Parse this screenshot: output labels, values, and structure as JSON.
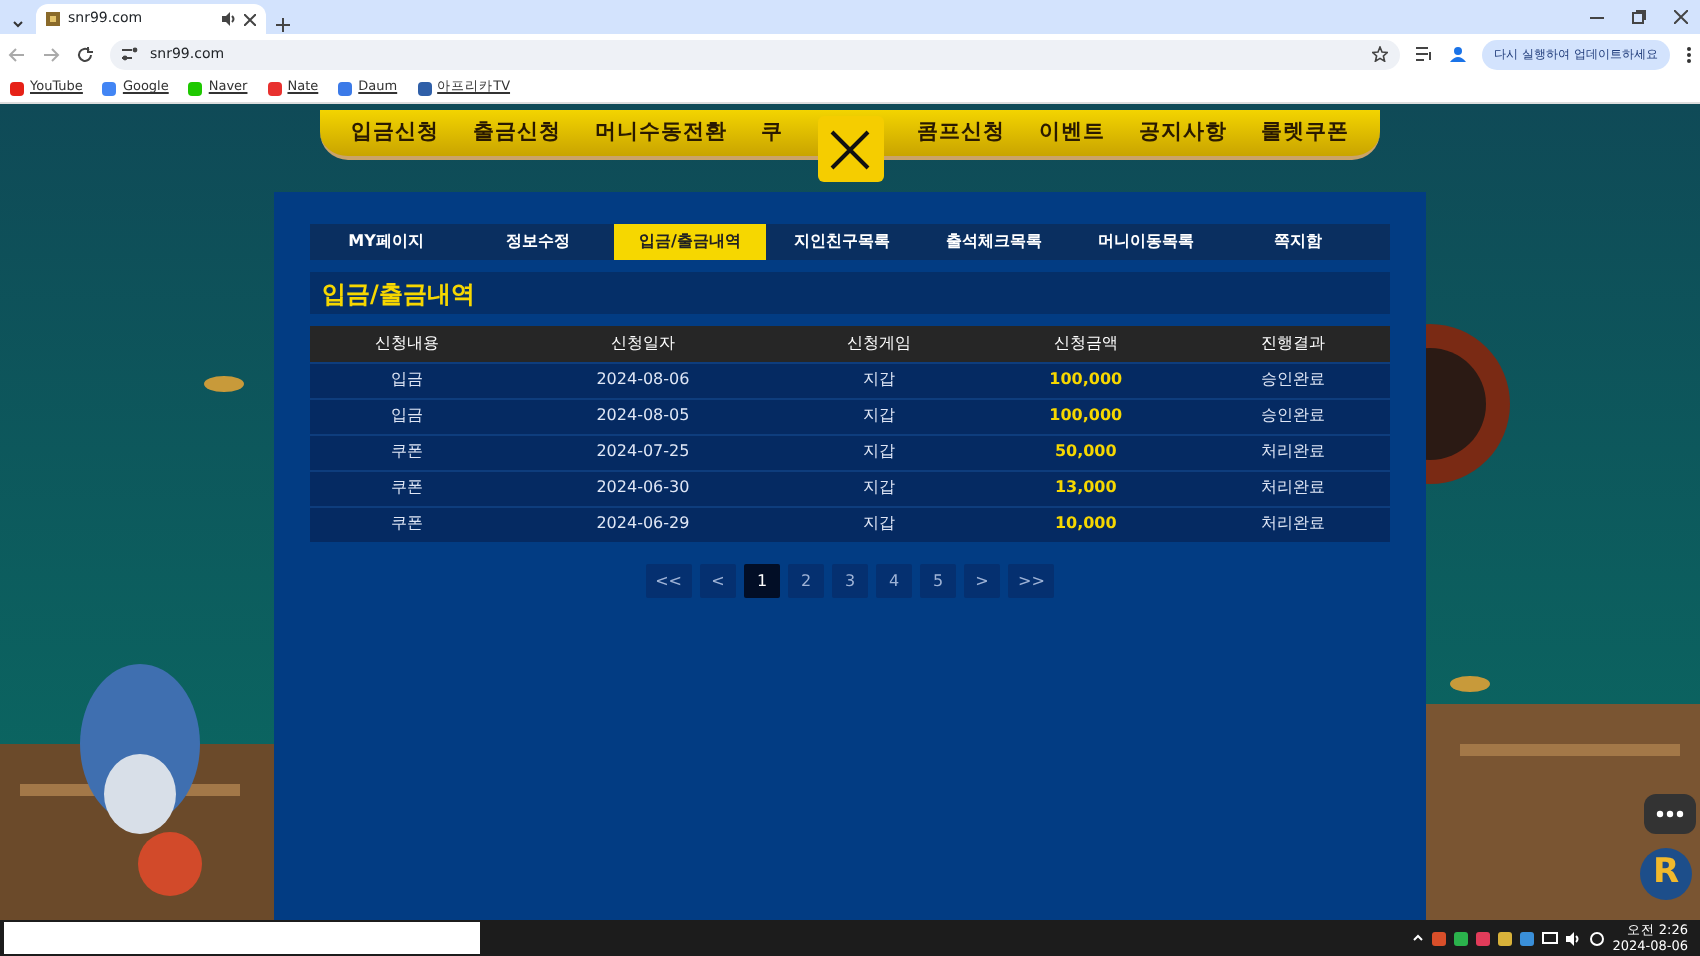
{
  "browser": {
    "tab": {
      "title": "snr99.com"
    },
    "address": "snr99.com",
    "update_button": "다시 실행하여 업데이트하세요",
    "bookmarks": [
      {
        "label": "YouTube",
        "color": "#e62117"
      },
      {
        "label": "Google",
        "color": "#4285f4"
      },
      {
        "label": "Naver",
        "color": "#1ec800"
      },
      {
        "label": "Nate",
        "color": "#e8312f"
      },
      {
        "label": "Daum",
        "color": "#3b7ae8"
      },
      {
        "label": "아프리카TV",
        "color": "#2f5fa8"
      }
    ]
  },
  "site_nav": {
    "items": [
      "입금신청",
      "출금신청",
      "머니수동전환",
      "쿠",
      "콤프신청",
      "이벤트",
      "공지사항",
      "룰렛쿠폰"
    ]
  },
  "modal": {
    "tabs": [
      {
        "label": "MY페이지",
        "selected": false
      },
      {
        "label": "정보수정",
        "selected": false
      },
      {
        "label": "입금/출금내역",
        "selected": true
      },
      {
        "label": "지인친구목록",
        "selected": false
      },
      {
        "label": "출석체크목록",
        "selected": false
      },
      {
        "label": "머니이동목록",
        "selected": false
      },
      {
        "label": "쪽지함",
        "selected": false
      }
    ],
    "heading": "입금/출금내역",
    "table": {
      "columns": [
        "신청내용",
        "신청일자",
        "신청게임",
        "신청금액",
        "진행결과"
      ],
      "rows": [
        [
          "입금",
          "2024-08-06",
          "지갑",
          "100,000",
          "승인완료"
        ],
        [
          "입금",
          "2024-08-05",
          "지갑",
          "100,000",
          "승인완료"
        ],
        [
          "쿠폰",
          "2024-07-25",
          "지갑",
          "50,000",
          "처리완료"
        ],
        [
          "쿠폰",
          "2024-06-30",
          "지갑",
          "13,000",
          "처리완료"
        ],
        [
          "쿠폰",
          "2024-06-29",
          "지갑",
          "10,000",
          "처리완료"
        ]
      ]
    },
    "pagination": [
      {
        "label": "<<",
        "selected": false
      },
      {
        "label": "<",
        "selected": false
      },
      {
        "label": "1",
        "selected": true
      },
      {
        "label": "2",
        "selected": false
      },
      {
        "label": "3",
        "selected": false
      },
      {
        "label": "4",
        "selected": false
      },
      {
        "label": "5",
        "selected": false
      },
      {
        "label": ">",
        "selected": false
      },
      {
        "label": ">>",
        "selected": false
      }
    ]
  },
  "floating_logo": "R",
  "taskbar": {
    "time": "오전 2:26",
    "date": "2024-08-06"
  }
}
